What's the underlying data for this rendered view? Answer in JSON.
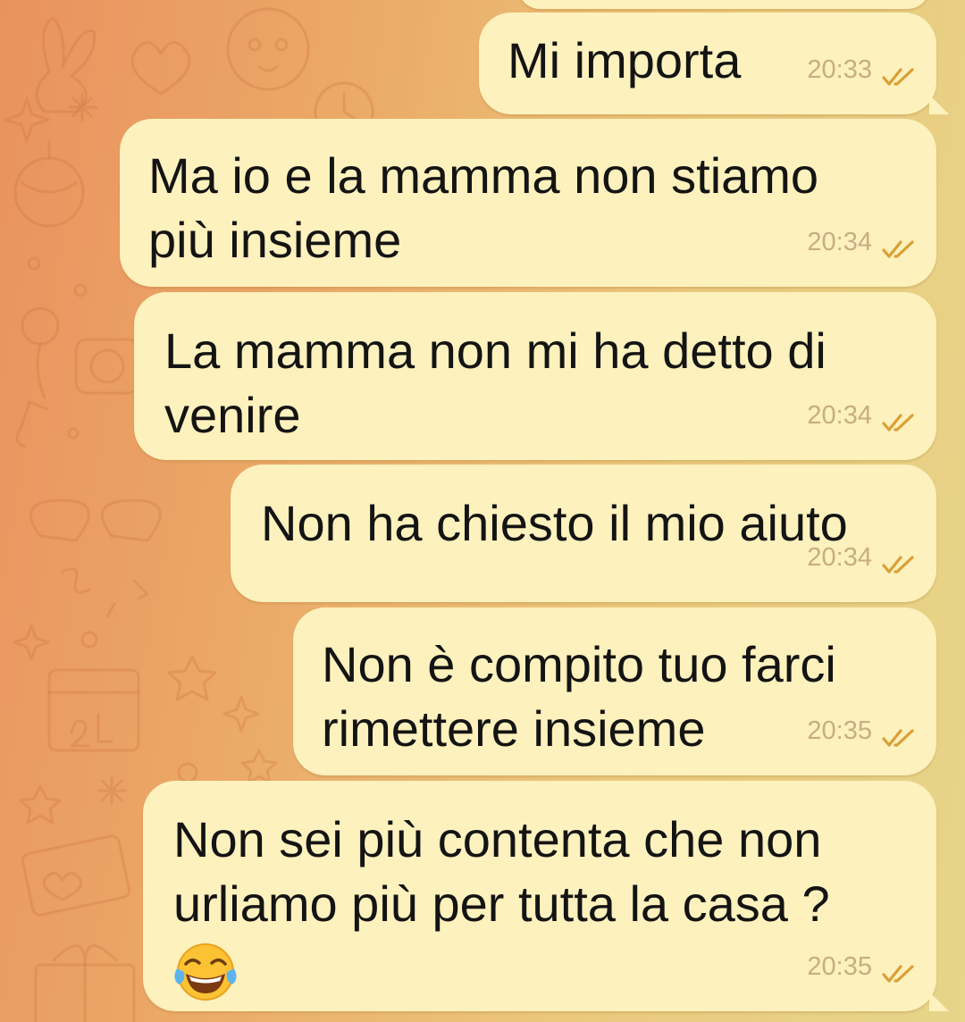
{
  "messages": [
    {
      "text": "Mi importa",
      "time": "20:33",
      "status": "read-double-check"
    },
    {
      "text": "Ma io e la mamma non stiamo\npiù insieme",
      "time": "20:34",
      "status": "read-double-check"
    },
    {
      "text": "La mamma non mi ha detto di\nvenire",
      "time": "20:34",
      "status": "read-double-check"
    },
    {
      "text": "Non ha chiesto il mio aiuto",
      "time": "20:34",
      "status": "read-double-check"
    },
    {
      "text": "Non è compito tuo farci\nrimettere insieme",
      "time": "20:35",
      "status": "read-double-check"
    },
    {
      "text": "Non sei più contenta che non\nurliamo più per tutta la casa ?",
      "emoji": "face-with-tears-of-joy",
      "time": "20:35",
      "status": "read-double-check"
    }
  ],
  "colors": {
    "bubble": "#fdf1bd",
    "text": "#141414",
    "time": "#c7ad85",
    "check": "#d9a037",
    "wallpaper_left": "#e9925f",
    "wallpaper_right": "#e6d58a"
  }
}
